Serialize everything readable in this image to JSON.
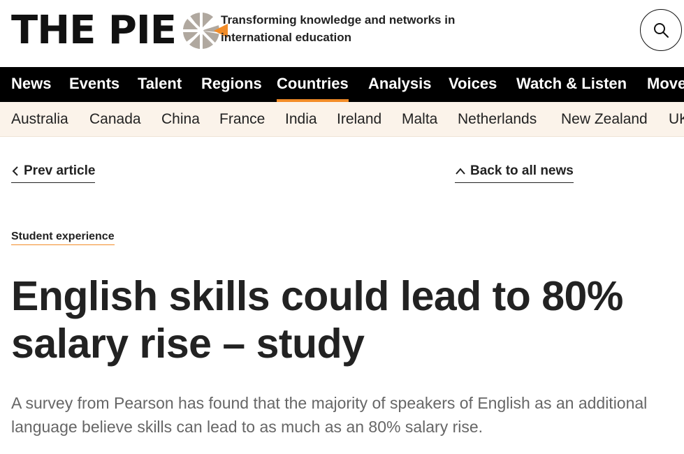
{
  "header": {
    "logo_text": "THE PIE",
    "tagline": "Transforming knowledge and networks in international education",
    "brand_color": "#f28c28",
    "search_icon": "search-icon"
  },
  "nav": {
    "items": [
      "News",
      "Events",
      "Talent",
      "Regions",
      "Countries",
      "Analysis",
      "Voices",
      "Watch & Listen",
      "Move"
    ],
    "active": "Countries"
  },
  "countries": {
    "items": [
      "Australia",
      "Canada",
      "China",
      "France",
      "India",
      "Ireland",
      "Malta",
      "Netherlands",
      "New Zealand",
      "UK"
    ]
  },
  "article": {
    "prev_label": "Prev article",
    "back_label": "Back to all news",
    "category": "Student experience",
    "headline": "English skills could lead to 80% salary rise – study",
    "summary": "A survey from Pearson has found that the majority of speakers of English as an additional language believe skills can lead to as much as an 80% salary rise."
  }
}
